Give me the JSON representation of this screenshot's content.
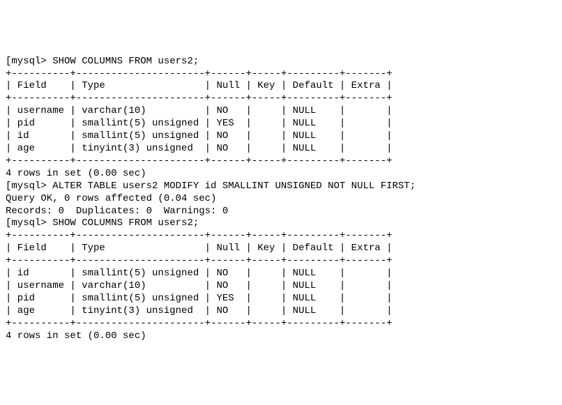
{
  "session": {
    "prompt": "mysql>",
    "cmd1": "SHOW COLUMNS FROM users2;",
    "table1": {
      "sep_top": "+----------+----------------------+------+-----+---------+-------+",
      "header": "| Field    | Type                 | Null | Key | Default | Extra |",
      "sep_mid": "+----------+----------------------+------+-----+---------+-------+",
      "rows": [
        "| username | varchar(10)          | NO   |     | NULL    |       |",
        "| pid      | smallint(5) unsigned | YES  |     | NULL    |       |",
        "| id       | smallint(5) unsigned | NO   |     | NULL    |       |",
        "| age      | tinyint(3) unsigned  | NO   |     | NULL    |       |"
      ],
      "sep_bot": "+----------+----------------------+------+-----+---------+-------+",
      "footer": "4 rows in set (0.00 sec)"
    },
    "cmd2": "ALTER TABLE users2 MODIFY id SMALLINT UNSIGNED NOT NULL FIRST;",
    "cmd2_result1": "Query OK, 0 rows affected (0.04 sec)",
    "cmd2_result2": "Records: 0  Duplicates: 0  Warnings: 0",
    "cmd3": "SHOW COLUMNS FROM users2;",
    "table2": {
      "sep_top": "+----------+----------------------+------+-----+---------+-------+",
      "header": "| Field    | Type                 | Null | Key | Default | Extra |",
      "sep_mid": "+----------+----------------------+------+-----+---------+-------+",
      "rows": [
        "| id       | smallint(5) unsigned | NO   |     | NULL    |       |",
        "| username | varchar(10)          | NO   |     | NULL    |       |",
        "| pid      | smallint(5) unsigned | YES  |     | NULL    |       |",
        "| age      | tinyint(3) unsigned  | NO   |     | NULL    |       |"
      ],
      "sep_bot": "+----------+----------------------+------+-----+---------+-------+",
      "footer": "4 rows in set (0.00 sec)"
    }
  },
  "chart_data": {
    "type": "table",
    "tables": [
      {
        "title": "SHOW COLUMNS FROM users2 (before ALTER)",
        "columns": [
          "Field",
          "Type",
          "Null",
          "Key",
          "Default",
          "Extra"
        ],
        "rows": [
          [
            "username",
            "varchar(10)",
            "NO",
            "",
            "NULL",
            ""
          ],
          [
            "pid",
            "smallint(5) unsigned",
            "YES",
            "",
            "NULL",
            ""
          ],
          [
            "id",
            "smallint(5) unsigned",
            "NO",
            "",
            "NULL",
            ""
          ],
          [
            "age",
            "tinyint(3) unsigned",
            "NO",
            "",
            "NULL",
            ""
          ]
        ],
        "footer": "4 rows in set (0.00 sec)"
      },
      {
        "title": "SHOW COLUMNS FROM users2 (after ALTER)",
        "columns": [
          "Field",
          "Type",
          "Null",
          "Key",
          "Default",
          "Extra"
        ],
        "rows": [
          [
            "id",
            "smallint(5) unsigned",
            "NO",
            "",
            "NULL",
            ""
          ],
          [
            "username",
            "varchar(10)",
            "NO",
            "",
            "NULL",
            ""
          ],
          [
            "pid",
            "smallint(5) unsigned",
            "YES",
            "",
            "NULL",
            ""
          ],
          [
            "age",
            "tinyint(3) unsigned",
            "NO",
            "",
            "NULL",
            ""
          ]
        ],
        "footer": "4 rows in set (0.00 sec)"
      }
    ],
    "commands": [
      "SHOW COLUMNS FROM users2;",
      "ALTER TABLE users2 MODIFY id SMALLINT UNSIGNED NOT NULL FIRST;",
      "SHOW COLUMNS FROM users2;"
    ],
    "alter_result": {
      "status": "Query OK",
      "rows_affected": 0,
      "duration_sec": 0.04,
      "records": 0,
      "duplicates": 0,
      "warnings": 0
    }
  }
}
